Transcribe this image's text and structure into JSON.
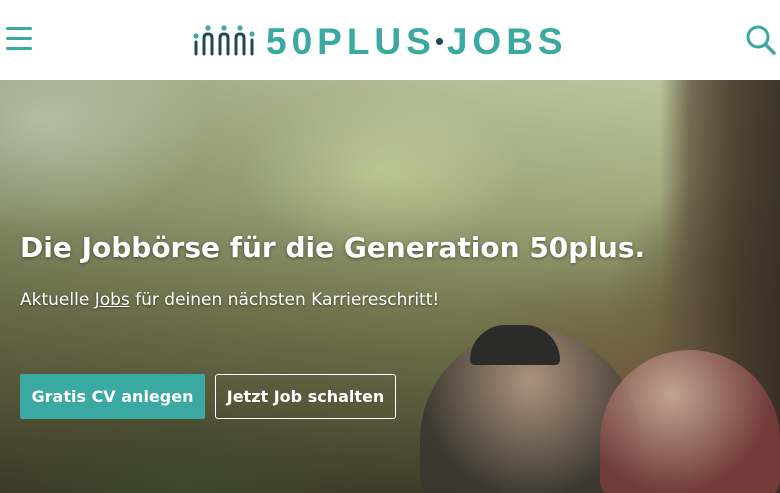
{
  "header": {
    "logo_text_left": "50PLUS",
    "logo_text_right": "JOBS",
    "logo_alt": "50plus Jobs"
  },
  "hero": {
    "title": "Die Jobbörse für die Generation 50plus.",
    "subtitle_before": "Aktuelle ",
    "subtitle_link": "Jobs",
    "subtitle_after": " für deinen nächsten Karriereschritt!",
    "primary_button": "Gratis CV anlegen",
    "secondary_button": "Jetzt Job schalten"
  },
  "colors": {
    "brand_teal": "#3aa9a2",
    "brand_dark": "#1d4a52",
    "text_on_image": "#ffffff"
  },
  "icons": {
    "menu": "hamburger-menu-icon",
    "search": "search-icon",
    "logo_mark": "people-wave-logo-icon"
  }
}
